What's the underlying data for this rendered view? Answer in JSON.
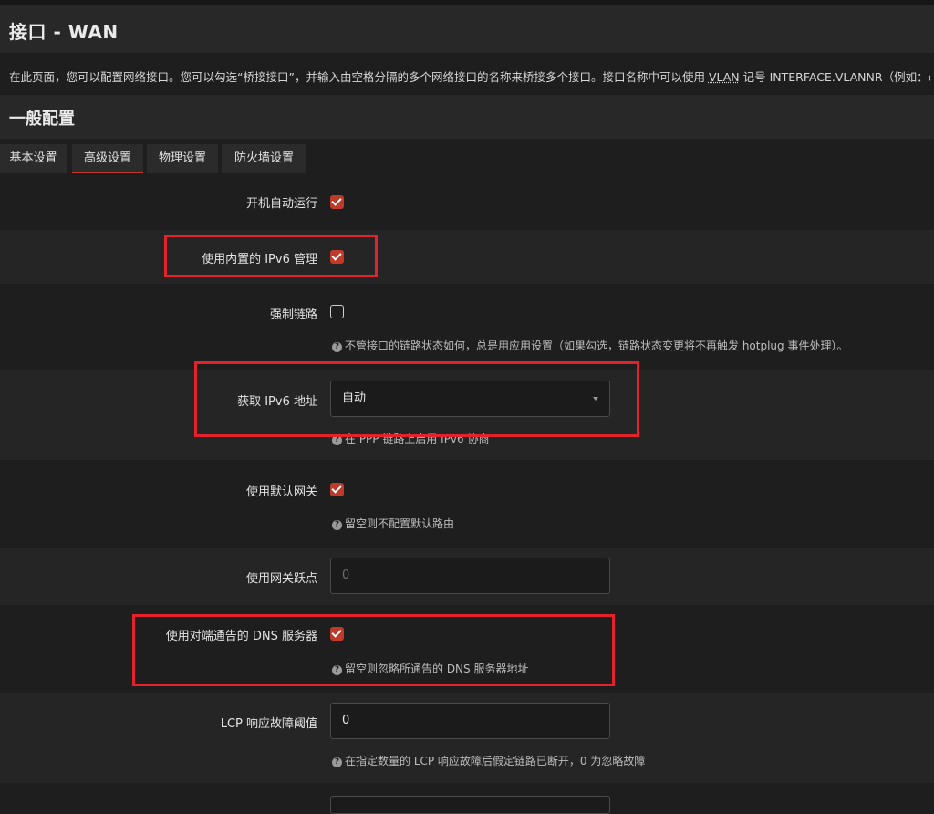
{
  "page": {
    "title": "接口 - WAN"
  },
  "description": {
    "before_vlan": "在此页面，您可以配置网络接口。您可以勾选“桥接接口”，并输入由空格分隔的多个网络接口的名称来桥接多个接口。接口名称中可以使用 ",
    "vlan": "VLAN",
    "after_vlan": " 记号 INTERFACE.VLANNR（例如：et"
  },
  "section": {
    "title": "一般配置"
  },
  "tabs": [
    {
      "label": "基本设置",
      "active": false
    },
    {
      "label": "高级设置",
      "active": true
    },
    {
      "label": "物理设置",
      "active": false
    },
    {
      "label": "防火墙设置",
      "active": false
    }
  ],
  "fields": {
    "auto_start": {
      "label": "开机自动运行",
      "checked": true
    },
    "builtin_ipv6": {
      "label": "使用内置的 IPv6 管理",
      "checked": true
    },
    "force_link": {
      "label": "强制链路",
      "checked": false,
      "help": "不管接口的链路状态如何，总是用应用设置（如果勾选，链路状态变更将不再触发 hotplug 事件处理）。"
    },
    "obtain_ipv6": {
      "label": "获取 IPv6 地址",
      "value": "自动",
      "help": "在 PPP 链路上启用 IPv6 协商"
    },
    "default_gateway": {
      "label": "使用默认网关",
      "checked": true,
      "help": "留空则不配置默认路由"
    },
    "gateway_metric": {
      "label": "使用网关跃点",
      "placeholder": "0"
    },
    "peer_dns": {
      "label": "使用对端通告的 DNS 服务器",
      "checked": true,
      "help": "留空则忽略所通告的 DNS 服务器地址"
    },
    "lcp_threshold": {
      "label": "LCP 响应故障阈值",
      "value": "0",
      "help": "在指定数量的 LCP 响应故障后假定链路已断开，0 为忽略故障"
    }
  },
  "icons": {
    "help": "question-circle-icon",
    "select": "chevron-down-icon"
  },
  "colors": {
    "accent": "#c0392b",
    "highlight": "#e4222b",
    "background": "#1e1e1e"
  }
}
